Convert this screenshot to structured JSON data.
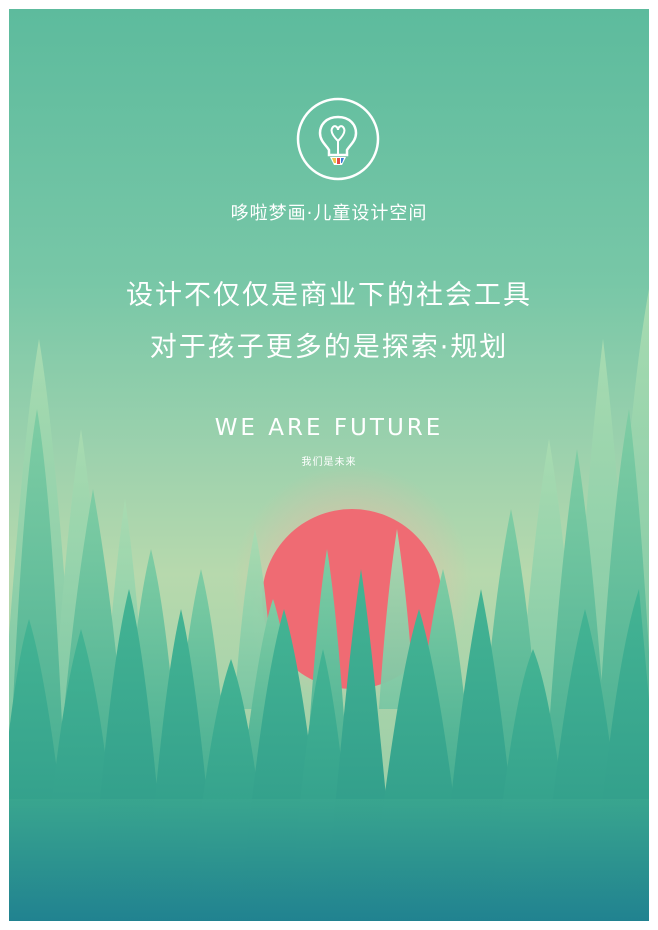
{
  "poster": {
    "brand_name": "哆啦梦画·儿童设计空间",
    "slogan_line1": "设计不仅仅是商业下的社会工具",
    "slogan_line2": "对于孩子更多的是探索·规划",
    "tagline_en": "WE ARE FUTURE",
    "tagline_cn": "我们是未来"
  },
  "logo": {
    "icon": "lightbulb-heart-icon"
  },
  "colors": {
    "background_top": "#5dbb9d",
    "background_mid": "#b7d9ad",
    "sun": "#ef6b73",
    "tree_light": "#8fd2a8",
    "tree_mid": "#4fb894",
    "tree_dark": "#2f9e89",
    "text": "#ffffff"
  }
}
